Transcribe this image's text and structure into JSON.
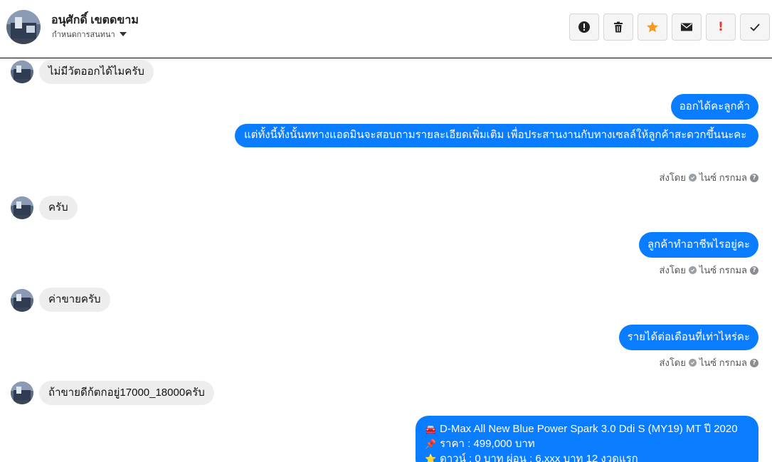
{
  "header": {
    "contact_name": "อนุศักดิ์ เขตดขาม",
    "status": "กำหนดการสนทนา",
    "actions": [
      {
        "name": "alert-button",
        "icon": "alert-circle-icon"
      },
      {
        "name": "delete-button",
        "icon": "trash-icon"
      },
      {
        "name": "star-button",
        "icon": "star-icon"
      },
      {
        "name": "mark-unread-button",
        "icon": "envelope-icon"
      },
      {
        "name": "spam-button",
        "icon": "exclamation-icon"
      },
      {
        "name": "done-button",
        "icon": "check-icon"
      }
    ],
    "exclamation": "!"
  },
  "colors": {
    "outgoing_bubble": "#0a7cff",
    "incoming_bubble": "#ededed",
    "star": "#f29b22",
    "spam": "#e53935"
  },
  "messages": [
    {
      "dir": "in",
      "text": "ไม่มีวัตออกได้ไมครับ"
    },
    {
      "dir": "out",
      "text": "ออกได้คะลูกค้า"
    },
    {
      "dir": "out",
      "text": "แต่ทั้งนี้ทั้งนั้นททางแอดมินจะสอบถามรายละเอียดเพิ่มเติม เพื่อประสานงานกับทางเซลล์ให้ลูกค้าสะดวกขึ้นนะคะ",
      "sent_by": "ส่งโดย",
      "sender": "ไนซ์ กรกมล"
    },
    {
      "dir": "in",
      "text": "ครับ"
    },
    {
      "dir": "out",
      "text": "ลูกค้าทำอาชีพไรอยู่คะ",
      "sent_by": "ส่งโดย",
      "sender": "ไนซ์ กรกมล"
    },
    {
      "dir": "in",
      "text": "ค่าขายครับ"
    },
    {
      "dir": "out",
      "text": "รายได้ต่อเดือนที่เท่าไหร่คะ",
      "sent_by": "ส่งโดย",
      "sender": "ไนซ์ กรกมล"
    },
    {
      "dir": "in",
      "text": "ถ้าขายดีก้ตกอยู่17000_18000ครับ"
    },
    {
      "dir": "out",
      "card": [
        {
          "icon": "🚘",
          "text": "D-Max All New Blue Power Spark 3.0 Ddi S (MY19) MT ปี 2020"
        },
        {
          "icon": "📌",
          "text": "ราคา : 499,000 บาท"
        },
        {
          "icon": "⭐",
          "text": "ดาวน์ : 0 บาท ผ่อน : 6,xxx บาท 12 งวดแรก"
        }
      ]
    }
  ],
  "help_icon": "?"
}
